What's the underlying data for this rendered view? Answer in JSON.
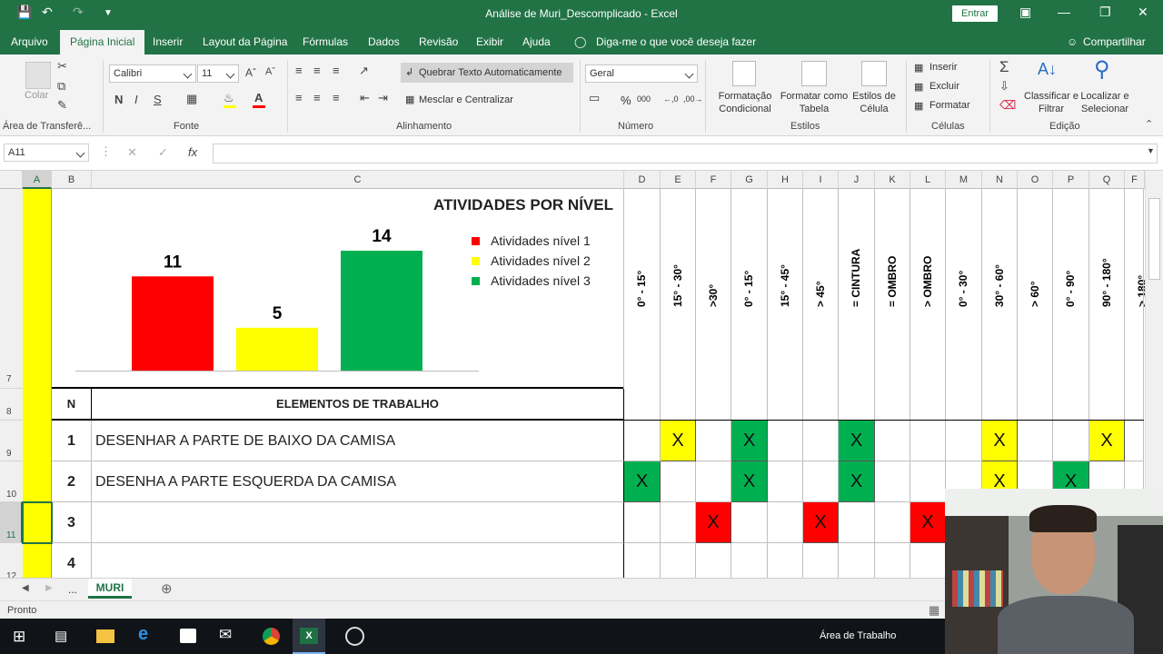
{
  "window": {
    "title": "Análise de Muri_Descomplicado  -  Excel",
    "signin_label": "Entrar"
  },
  "menu": {
    "tabs": [
      "Arquivo",
      "Página Inicial",
      "Inserir",
      "Layout da Página",
      "Fórmulas",
      "Dados",
      "Revisão",
      "Exibir",
      "Ajuda"
    ],
    "tell_me": "Diga-me o que você deseja fazer",
    "share": "Compartilhar"
  },
  "ribbon": {
    "clipboard": {
      "paste": "Colar",
      "label": "Área de Transferê..."
    },
    "font": {
      "name": "Calibri",
      "size": "11",
      "label": "Fonte",
      "bold": "N",
      "italic": "I",
      "underline": "S"
    },
    "alignment": {
      "wrap": "Quebrar Texto Automaticamente",
      "merge": "Mesclar e Centralizar",
      "label": "Alinhamento"
    },
    "number": {
      "format": "Geral",
      "percent": "%",
      "thousands": "000",
      "label": "Número"
    },
    "styles": {
      "conditional": "Formatação Condicional",
      "as_table": "Formatar como Tabela",
      "cell_styles": "Estilos de Célula",
      "label": "Estilos"
    },
    "cells": {
      "insert": "Inserir",
      "delete": "Excluir",
      "format": "Formatar",
      "label": "Células"
    },
    "editing": {
      "sort": "Classificar e Filtrar",
      "find": "Localizar e Selecionar",
      "label": "Edição"
    }
  },
  "formula_bar": {
    "name_box": "A11",
    "fx": "fx",
    "value": ""
  },
  "columns": [
    "A",
    "B",
    "C",
    "D",
    "E",
    "F",
    "G",
    "H",
    "I",
    "J",
    "K",
    "L",
    "M",
    "N",
    "O",
    "P",
    "Q",
    "F"
  ],
  "rows": [
    "7",
    "8",
    "9",
    "10",
    "11",
    "12"
  ],
  "chart_data": {
    "type": "bar",
    "title": "ATIVIDADES POR NÍVEL",
    "categories": [
      "Atividades nível 1",
      "Atividades nível 2",
      "Atividades nível 3"
    ],
    "values": [
      11,
      5,
      14
    ],
    "colors": [
      "#ff0000",
      "#ffff00",
      "#00b050"
    ],
    "legend": "top-right",
    "data_labels": true
  },
  "table": {
    "header_n": "N",
    "header_elements": "ELEMENTOS DE TRABALHO",
    "angle_headers": [
      "0° - 15°",
      "15° - 30°",
      ">30°",
      "0° - 15°",
      "15° - 45°",
      "> 45°",
      "= CINTURA",
      "= OMBRO",
      "> OMBRO",
      "0° - 30°",
      "30° - 60°",
      "> 60°",
      "0° - 90°",
      "90° - 180°",
      "> 180°"
    ],
    "rows": [
      {
        "n": "1",
        "text": "DESENHAR A PARTE DE BAIXO DA CAMISA"
      },
      {
        "n": "2",
        "text": "DESENHA A PARTE ESQUERDA DA CAMISA"
      },
      {
        "n": "3",
        "text": ""
      },
      {
        "n": "4",
        "text": ""
      }
    ],
    "mark": "X"
  },
  "sheets": {
    "ellipsis": "...",
    "active": "MURI"
  },
  "status": {
    "ready": "Pronto"
  },
  "taskbar": {
    "desktop": "Área de Trabalho"
  }
}
